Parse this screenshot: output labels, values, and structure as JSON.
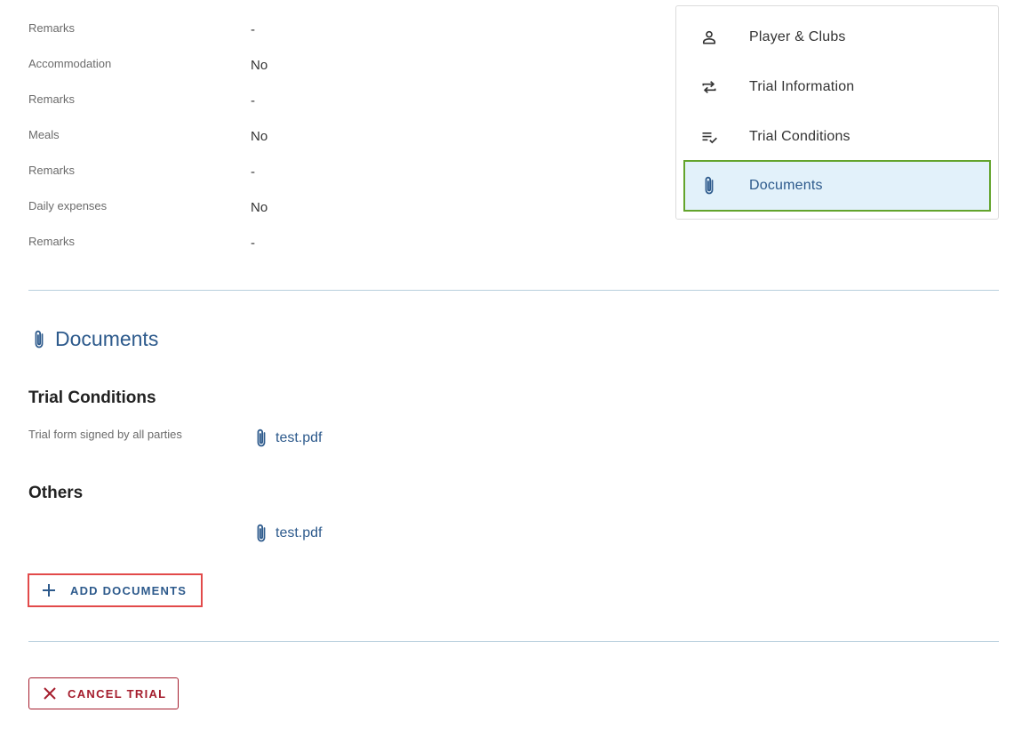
{
  "details": {
    "rows": [
      {
        "label": "Remarks",
        "value": "-"
      },
      {
        "label": "Accommodation",
        "value": "No"
      },
      {
        "label": "Remarks",
        "value": "-"
      },
      {
        "label": "Meals",
        "value": "No"
      },
      {
        "label": "Remarks",
        "value": "-"
      },
      {
        "label": "Daily expenses",
        "value": "No"
      },
      {
        "label": "Remarks",
        "value": "-"
      }
    ]
  },
  "nav": {
    "items": [
      {
        "label": "Player & Clubs",
        "icon": "person-icon",
        "active": false
      },
      {
        "label": "Trial Information",
        "icon": "repeat-icon",
        "active": false
      },
      {
        "label": "Trial Conditions",
        "icon": "checklist-icon",
        "active": false
      },
      {
        "label": "Documents",
        "icon": "paperclip-icon",
        "active": true
      }
    ]
  },
  "documents": {
    "title": "Documents",
    "groups": [
      {
        "heading": "Trial Conditions",
        "items": [
          {
            "label": "Trial form signed by all parties",
            "file": "test.pdf"
          }
        ]
      },
      {
        "heading": "Others",
        "items": [
          {
            "label": "",
            "file": "test.pdf"
          }
        ]
      }
    ],
    "add_label": "ADD DOCUMENTS"
  },
  "actions": {
    "cancel_label": "CANCEL TRIAL"
  },
  "colors": {
    "accent": "#2d5a8c",
    "active_bg": "#e2f1fa",
    "active_border": "#63a42c",
    "add_border": "#e24a4a",
    "danger": "#a51d2d"
  }
}
